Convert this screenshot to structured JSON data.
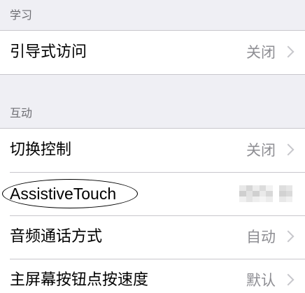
{
  "sections": [
    {
      "header": "学习",
      "rows": [
        {
          "label": "引导式访问",
          "value": "关闭"
        }
      ]
    },
    {
      "header": "互动",
      "rows": [
        {
          "label": "切换控制",
          "value": "关闭"
        },
        {
          "label": "AssistiveTouch",
          "value": ""
        },
        {
          "label": "音频通话方式",
          "value": "自动"
        },
        {
          "label": "主屏幕按钮点按速度",
          "value": "默认"
        }
      ]
    }
  ],
  "icons": {
    "chevron": "chevron-right-icon"
  },
  "colors": {
    "background": "#efeff4",
    "row_background": "#ffffff",
    "header_text": "#6d6d72",
    "value_text": "#8e8e93",
    "separator": "#c8c7cc"
  }
}
